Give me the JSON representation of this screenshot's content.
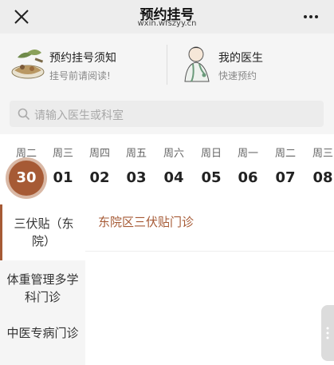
{
  "header": {
    "title": "预约挂号",
    "subtitle": "wxin.wfszyy.cn",
    "close_icon": "close-icon",
    "more_icon": "more-icon"
  },
  "entries": [
    {
      "title": "预约挂号须知",
      "subtitle": "挂号前请阅读!",
      "icon": "herbal-medicine-icon"
    },
    {
      "title": "我的医生",
      "subtitle": "快速预约",
      "icon": "doctor-icon"
    }
  ],
  "search": {
    "placeholder": "请输入医生或科室",
    "icon": "search-icon"
  },
  "dates": [
    {
      "weekday": "周二",
      "day": "30",
      "selected": true
    },
    {
      "weekday": "周三",
      "day": "01"
    },
    {
      "weekday": "周四",
      "day": "02"
    },
    {
      "weekday": "周五",
      "day": "03"
    },
    {
      "weekday": "周六",
      "day": "04"
    },
    {
      "weekday": "周日",
      "day": "05"
    },
    {
      "weekday": "周一",
      "day": "06"
    },
    {
      "weekday": "周二",
      "day": "07"
    },
    {
      "weekday": "周三",
      "day": "08"
    }
  ],
  "sidebar": {
    "items": [
      {
        "label": "三伏贴（东院）",
        "active": true
      },
      {
        "label": "体重管理多学科门诊"
      },
      {
        "label": "中医专病门诊"
      }
    ]
  },
  "departments": [
    {
      "label": "东院区三伏贴门诊"
    }
  ],
  "colors": {
    "accent": "#a65a35",
    "selected_ring": "#d9b8a5"
  }
}
